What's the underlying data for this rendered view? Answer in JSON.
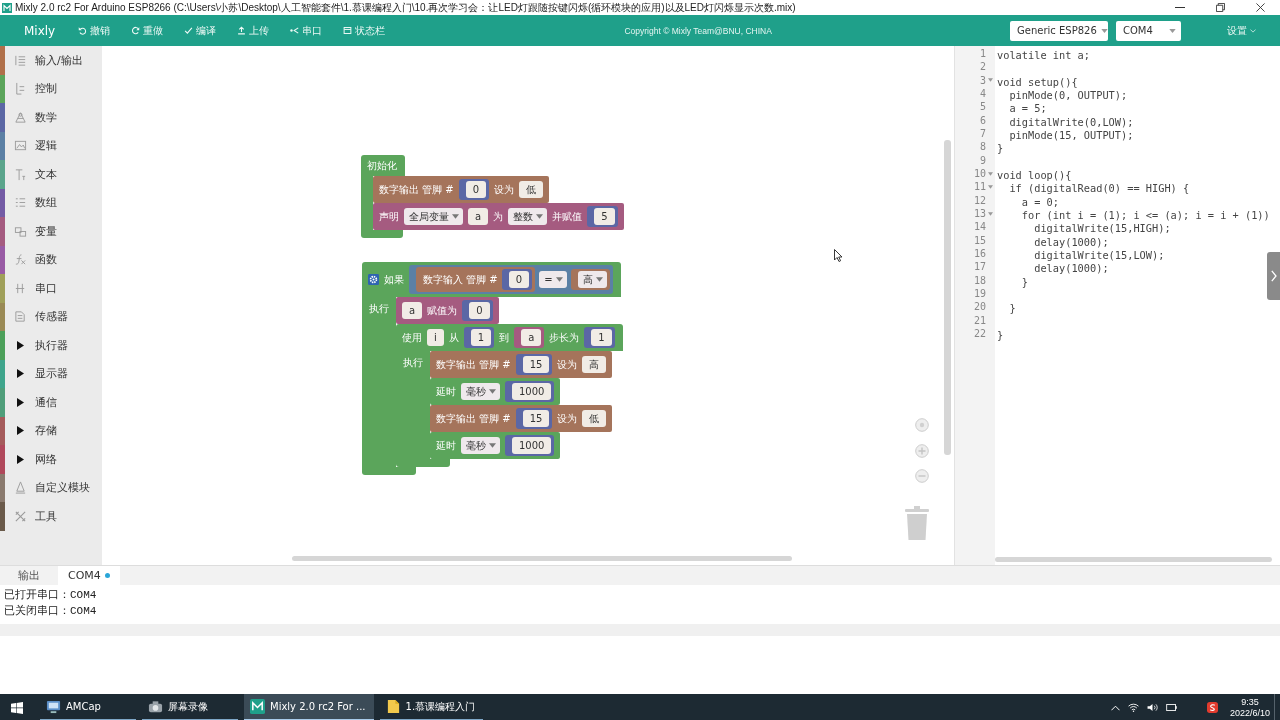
{
  "window": {
    "title": "Mixly 2.0 rc2 For Arduino ESP8266 (C:\\Users\\小苏\\Desktop\\人工智能套件\\1.慕课编程入门\\10.再次学习会：让LED灯跟随按键闪烁(循环模块的应用)以及LED灯闪烁显示次数.mix)"
  },
  "toolbar": {
    "logo": "Mixly",
    "buttons": [
      "撤销",
      "重做",
      "编译",
      "上传",
      "串口",
      "状态栏"
    ],
    "copyright": "Copyright © Mixly Team@BNU, CHINA",
    "board": "Generic ESP826",
    "port": "COM4",
    "settings": "设置"
  },
  "sidebar": {
    "categories": [
      {
        "label": "输入/输出",
        "color": "#b0704a",
        "kind": "category"
      },
      {
        "label": "控制",
        "color": "#5ba55b",
        "kind": "category"
      },
      {
        "label": "数学",
        "color": "#5b67a5",
        "kind": "category"
      },
      {
        "label": "逻辑",
        "color": "#5b80a5",
        "kind": "category"
      },
      {
        "label": "文本",
        "color": "#5ba58c",
        "kind": "category"
      },
      {
        "label": "数组",
        "color": "#745ba5",
        "kind": "category"
      },
      {
        "label": "变量",
        "color": "#a55b80",
        "kind": "category"
      },
      {
        "label": "函数",
        "color": "#995ba5",
        "kind": "category"
      },
      {
        "label": "串口",
        "color": "#a0a05a",
        "kind": "category"
      },
      {
        "label": "传感器",
        "color": "#9a8a55",
        "kind": "category"
      },
      {
        "label": "执行器",
        "color": "#4ca05a",
        "kind": "group"
      },
      {
        "label": "显示器",
        "color": "#3fa58c",
        "kind": "group"
      },
      {
        "label": "通信",
        "color": "#4f9e7a",
        "kind": "group"
      },
      {
        "label": "存储",
        "color": "#a55b5b",
        "kind": "group"
      },
      {
        "label": "网络",
        "color": "#b0485b",
        "kind": "group"
      },
      {
        "label": "自定义模块",
        "color": "#8a7a6e",
        "kind": "category"
      },
      {
        "label": "工具",
        "color": "#6a5a4a",
        "kind": "category"
      }
    ]
  },
  "workspace": {
    "blocks": [
      {
        "kind": "c-block",
        "color": "#5ba55b",
        "mutator": false,
        "header": [
          {
            "kind": "label",
            "text": "初始化"
          }
        ],
        "body": [
          {
            "kind": "statement",
            "color": "#a5745b",
            "parts": [
              {
                "kind": "label",
                "text": "数字输出 管脚 #"
              },
              {
                "kind": "value",
                "color": "#5b67a5",
                "parts": [
                  {
                    "kind": "field",
                    "text": "0"
                  }
                ]
              },
              {
                "kind": "label",
                "text": "设为"
              },
              {
                "kind": "field",
                "text": "低"
              }
            ]
          },
          {
            "kind": "statement",
            "color": "#a55b80",
            "parts": [
              {
                "kind": "label",
                "text": "声明"
              },
              {
                "kind": "dropdown",
                "text": "全局变量"
              },
              {
                "kind": "field",
                "text": "a"
              },
              {
                "kind": "label",
                "text": "为"
              },
              {
                "kind": "dropdown",
                "text": "整数"
              },
              {
                "kind": "label",
                "text": "并赋值"
              },
              {
                "kind": "value",
                "color": "#5b67a5",
                "parts": [
                  {
                    "kind": "field",
                    "text": "5"
                  }
                ]
              }
            ]
          }
        ]
      },
      {
        "kind": "c-block",
        "color": "#5ba55b",
        "mutator": true,
        "header": [
          {
            "kind": "label",
            "text": "如果"
          },
          {
            "kind": "value",
            "color": "#5b80a5",
            "parts": [
              {
                "kind": "value",
                "color": "#a5745b",
                "parts": [
                  {
                    "kind": "label",
                    "text": "数字输入 管脚 #"
                  },
                  {
                    "kind": "value",
                    "color": "#5b67a5",
                    "parts": [
                      {
                        "kind": "field",
                        "text": "0"
                      }
                    ]
                  }
                ]
              },
              {
                "kind": "dropdown",
                "text": "="
              },
              {
                "kind": "value",
                "color": "#a5745b",
                "parts": [
                  {
                    "kind": "dropdown",
                    "text": "高"
                  }
                ]
              }
            ]
          }
        ],
        "body_label": "执行",
        "body": [
          {
            "kind": "statement",
            "color": "#a55b80",
            "parts": [
              {
                "kind": "field",
                "text": "a"
              },
              {
                "kind": "label",
                "text": "赋值为"
              },
              {
                "kind": "value",
                "color": "#5b67a5",
                "parts": [
                  {
                    "kind": "field",
                    "text": "0"
                  }
                ]
              }
            ]
          },
          {
            "kind": "c-block",
            "color": "#5ba55b",
            "mutator": false,
            "header": [
              {
                "kind": "label",
                "text": "使用"
              },
              {
                "kind": "field",
                "text": "i"
              },
              {
                "kind": "label",
                "text": "从"
              },
              {
                "kind": "value",
                "color": "#5b67a5",
                "parts": [
                  {
                    "kind": "field",
                    "text": "1"
                  }
                ]
              },
              {
                "kind": "label",
                "text": "到"
              },
              {
                "kind": "value",
                "color": "#a55b80",
                "parts": [
                  {
                    "kind": "field",
                    "text": "a"
                  }
                ]
              },
              {
                "kind": "label",
                "text": "步长为"
              },
              {
                "kind": "value",
                "color": "#5b67a5",
                "parts": [
                  {
                    "kind": "field",
                    "text": "1"
                  }
                ]
              }
            ],
            "body_label": "执行",
            "body": [
              {
                "kind": "statement",
                "color": "#a5745b",
                "parts": [
                  {
                    "kind": "label",
                    "text": "数字输出 管脚 #"
                  },
                  {
                    "kind": "value",
                    "color": "#5b67a5",
                    "parts": [
                      {
                        "kind": "field",
                        "text": "15"
                      }
                    ]
                  },
                  {
                    "kind": "label",
                    "text": "设为"
                  },
                  {
                    "kind": "field",
                    "text": "高"
                  }
                ]
              },
              {
                "kind": "statement",
                "color": "#5ba55b",
                "parts": [
                  {
                    "kind": "label",
                    "text": "延时"
                  },
                  {
                    "kind": "dropdown",
                    "text": "毫秒"
                  },
                  {
                    "kind": "value",
                    "color": "#5b67a5",
                    "parts": [
                      {
                        "kind": "field",
                        "text": "1000"
                      }
                    ]
                  }
                ]
              },
              {
                "kind": "statement",
                "color": "#a5745b",
                "parts": [
                  {
                    "kind": "label",
                    "text": "数字输出 管脚 #"
                  },
                  {
                    "kind": "value",
                    "color": "#5b67a5",
                    "parts": [
                      {
                        "kind": "field",
                        "text": "15"
                      }
                    ]
                  },
                  {
                    "kind": "label",
                    "text": "设为"
                  },
                  {
                    "kind": "field",
                    "text": "低"
                  }
                ]
              },
              {
                "kind": "statement",
                "color": "#5ba55b",
                "parts": [
                  {
                    "kind": "label",
                    "text": "延时"
                  },
                  {
                    "kind": "dropdown",
                    "text": "毫秒"
                  },
                  {
                    "kind": "value",
                    "color": "#5b67a5",
                    "parts": [
                      {
                        "kind": "field",
                        "text": "1000"
                      }
                    ]
                  }
                ]
              }
            ]
          }
        ]
      }
    ]
  },
  "code_editor": {
    "lines": [
      {
        "number": "1",
        "text": "volatile int a;",
        "foldable": false
      },
      {
        "number": "2",
        "foldable": false
      },
      {
        "number": "3",
        "text": "void setup(){",
        "foldable": true
      },
      {
        "number": "4",
        "text": "  pinMode(0, OUTPUT);",
        "foldable": false
      },
      {
        "number": "5",
        "text": "  a = 5;",
        "foldable": false
      },
      {
        "number": "6",
        "text": "  digitalWrite(0,LOW);",
        "foldable": false
      },
      {
        "number": "7",
        "text": "  pinMode(15, OUTPUT);",
        "foldable": false
      },
      {
        "number": "8",
        "text": "}",
        "foldable": false
      },
      {
        "number": "9",
        "foldable": false
      },
      {
        "number": "10",
        "text": "void loop(){",
        "foldable": true
      },
      {
        "number": "11",
        "text": "  if (digitalRead(0) == HIGH) {",
        "foldable": true
      },
      {
        "number": "12",
        "text": "    a = 0;",
        "foldable": false
      },
      {
        "number": "13",
        "text": "    for (int i = (1); i <= (a); i = i + (1))",
        "foldable": true
      },
      {
        "number": "14",
        "text": "      digitalWrite(15,HIGH);",
        "foldable": false
      },
      {
        "number": "15",
        "text": "      delay(1000);",
        "foldable": false
      },
      {
        "number": "16",
        "text": "      digitalWrite(15,LOW);",
        "foldable": false
      },
      {
        "number": "17",
        "text": "      delay(1000);",
        "foldable": false
      },
      {
        "number": "18",
        "text": "    }",
        "foldable": false
      },
      {
        "number": "19",
        "foldable": false
      },
      {
        "number": "20",
        "text": "  }",
        "foldable": false
      },
      {
        "number": "21",
        "foldable": false
      },
      {
        "number": "22",
        "text": "}",
        "foldable": false
      }
    ]
  },
  "output_panel": {
    "tabs": [
      {
        "label": "输出",
        "selected": false,
        "indicator": false
      },
      {
        "label": "COM4",
        "selected": true,
        "indicator": true
      }
    ],
    "lines": [
      "已打开串口：COM4",
      "已关闭串口：COM4"
    ]
  },
  "taskbar": {
    "apps": [
      {
        "label": "AMCap",
        "selected": false
      },
      {
        "label": "屏幕录像",
        "selected": false
      },
      {
        "label": "Mixly 2.0 rc2 For ...",
        "selected": true
      },
      {
        "label": "1.慕课编程入门",
        "selected": false
      }
    ],
    "time": "9:35",
    "date": "2022/6/10"
  }
}
